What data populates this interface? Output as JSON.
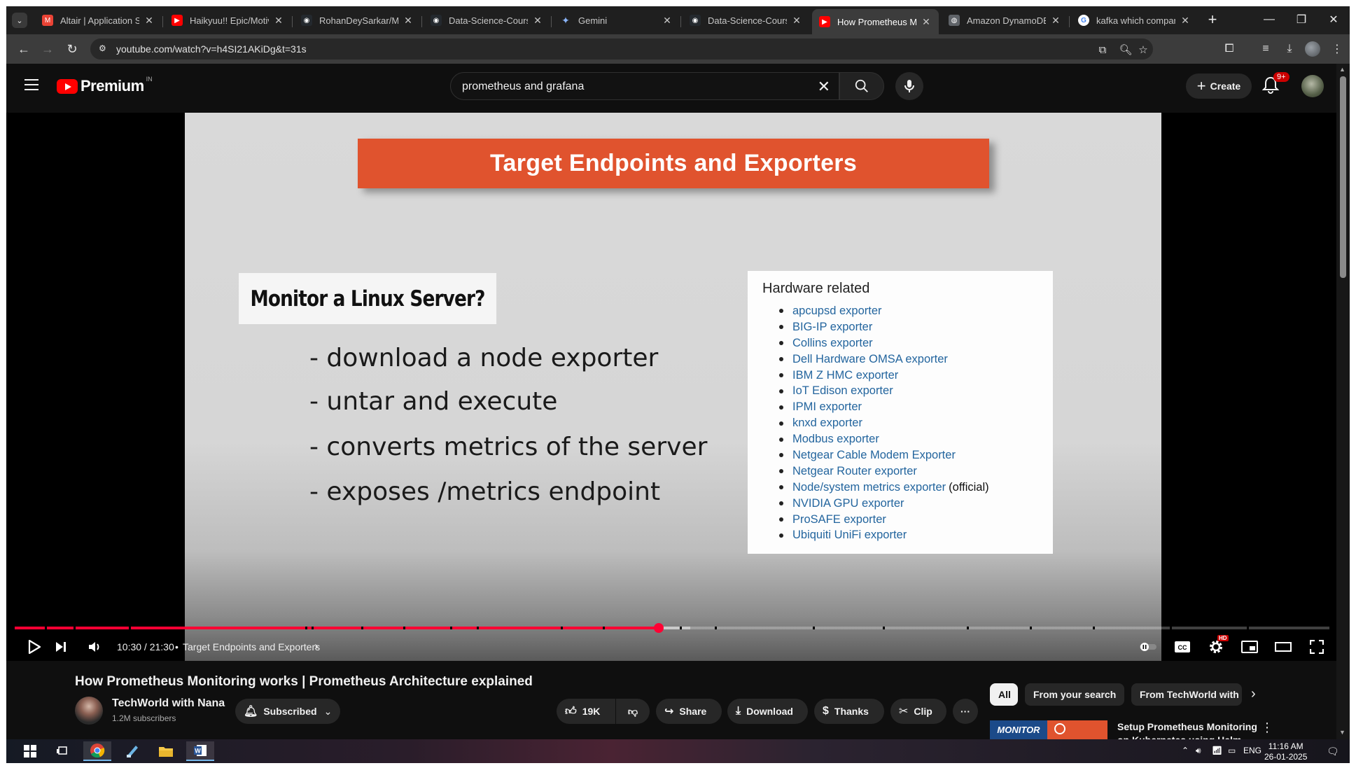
{
  "browser": {
    "tabs": [
      {
        "title": "Altair | Application St",
        "icon": "gmail-icon",
        "active": false
      },
      {
        "title": "Haikyuu!! Epic/Motiva",
        "icon": "youtube-icon",
        "active": false
      },
      {
        "title": "RohanDeySarkar/Misc",
        "icon": "github-icon",
        "active": false
      },
      {
        "title": "Data-Science-Course",
        "icon": "github-icon",
        "active": false
      },
      {
        "title": "Gemini",
        "icon": "gemini-icon",
        "active": false
      },
      {
        "title": "Data-Science-Course",
        "icon": "github-icon",
        "active": false
      },
      {
        "title": "How Prometheus Mo",
        "icon": "youtube-icon",
        "active": true
      },
      {
        "title": "Amazon DynamoDB",
        "icon": "globe-icon",
        "active": false
      },
      {
        "title": "kafka which company",
        "icon": "google-icon",
        "active": false
      }
    ],
    "url": "youtube.com/watch?v=h4SI21AKiDg&t=31s"
  },
  "youtube": {
    "logo_text": "Premium",
    "country_code": "IN",
    "search_query": "prometheus and grafana",
    "create_label": "Create",
    "notification_badge": "9+"
  },
  "slide": {
    "heading": "Target Endpoints and Exporters",
    "question": "Monitor a Linux Server?",
    "bullets": [
      "- download a node exporter",
      "- untar and execute",
      "- converts metrics of the server",
      "- exposes /metrics endpoint"
    ],
    "hardware_title": "Hardware related",
    "hardware_items": [
      {
        "name": "apcupsd exporter",
        "suffix": ""
      },
      {
        "name": "BIG-IP exporter",
        "suffix": ""
      },
      {
        "name": "Collins exporter",
        "suffix": ""
      },
      {
        "name": "Dell Hardware OMSA exporter",
        "suffix": ""
      },
      {
        "name": "IBM Z HMC exporter",
        "suffix": ""
      },
      {
        "name": "IoT Edison exporter",
        "suffix": ""
      },
      {
        "name": "IPMI exporter",
        "suffix": ""
      },
      {
        "name": "knxd exporter",
        "suffix": ""
      },
      {
        "name": "Modbus exporter",
        "suffix": ""
      },
      {
        "name": "Netgear Cable Modem Exporter",
        "suffix": ""
      },
      {
        "name": "Netgear Router exporter",
        "suffix": ""
      },
      {
        "name": "Node/system metrics exporter",
        "suffix": "(official)"
      },
      {
        "name": "NVIDIA GPU exporter",
        "suffix": ""
      },
      {
        "name": "ProSAFE exporter",
        "suffix": ""
      },
      {
        "name": "Ubiquiti UniFi exporter",
        "suffix": ""
      }
    ]
  },
  "player": {
    "time": "10:30 / 21:30",
    "chapter": "Target Endpoints and Exporters",
    "progress_fraction": 0.49,
    "settings_badge": "HD"
  },
  "video": {
    "title": "How Prometheus Monitoring works | Prometheus Architecture explained",
    "channel": "TechWorld with Nana",
    "subscribers": "1.2M subscribers",
    "subscribed_label": "Subscribed",
    "likes": "19K",
    "share_label": "Share",
    "download_label": "Download",
    "thanks_label": "Thanks",
    "clip_label": "Clip"
  },
  "recommendations": {
    "chips": [
      "All",
      "From your search",
      "From TechWorld with N"
    ],
    "first_title": "Setup Prometheus Monitoring on Kubernetes using Helm and",
    "first_thumb_text": "MONITOR"
  },
  "taskbar": {
    "lang": "ENG",
    "time": "11:16 AM",
    "date": "26-01-2025"
  },
  "colors": {
    "yt_red": "#ff0033",
    "slide_orange": "#e0532e",
    "link_blue": "#23659e"
  }
}
